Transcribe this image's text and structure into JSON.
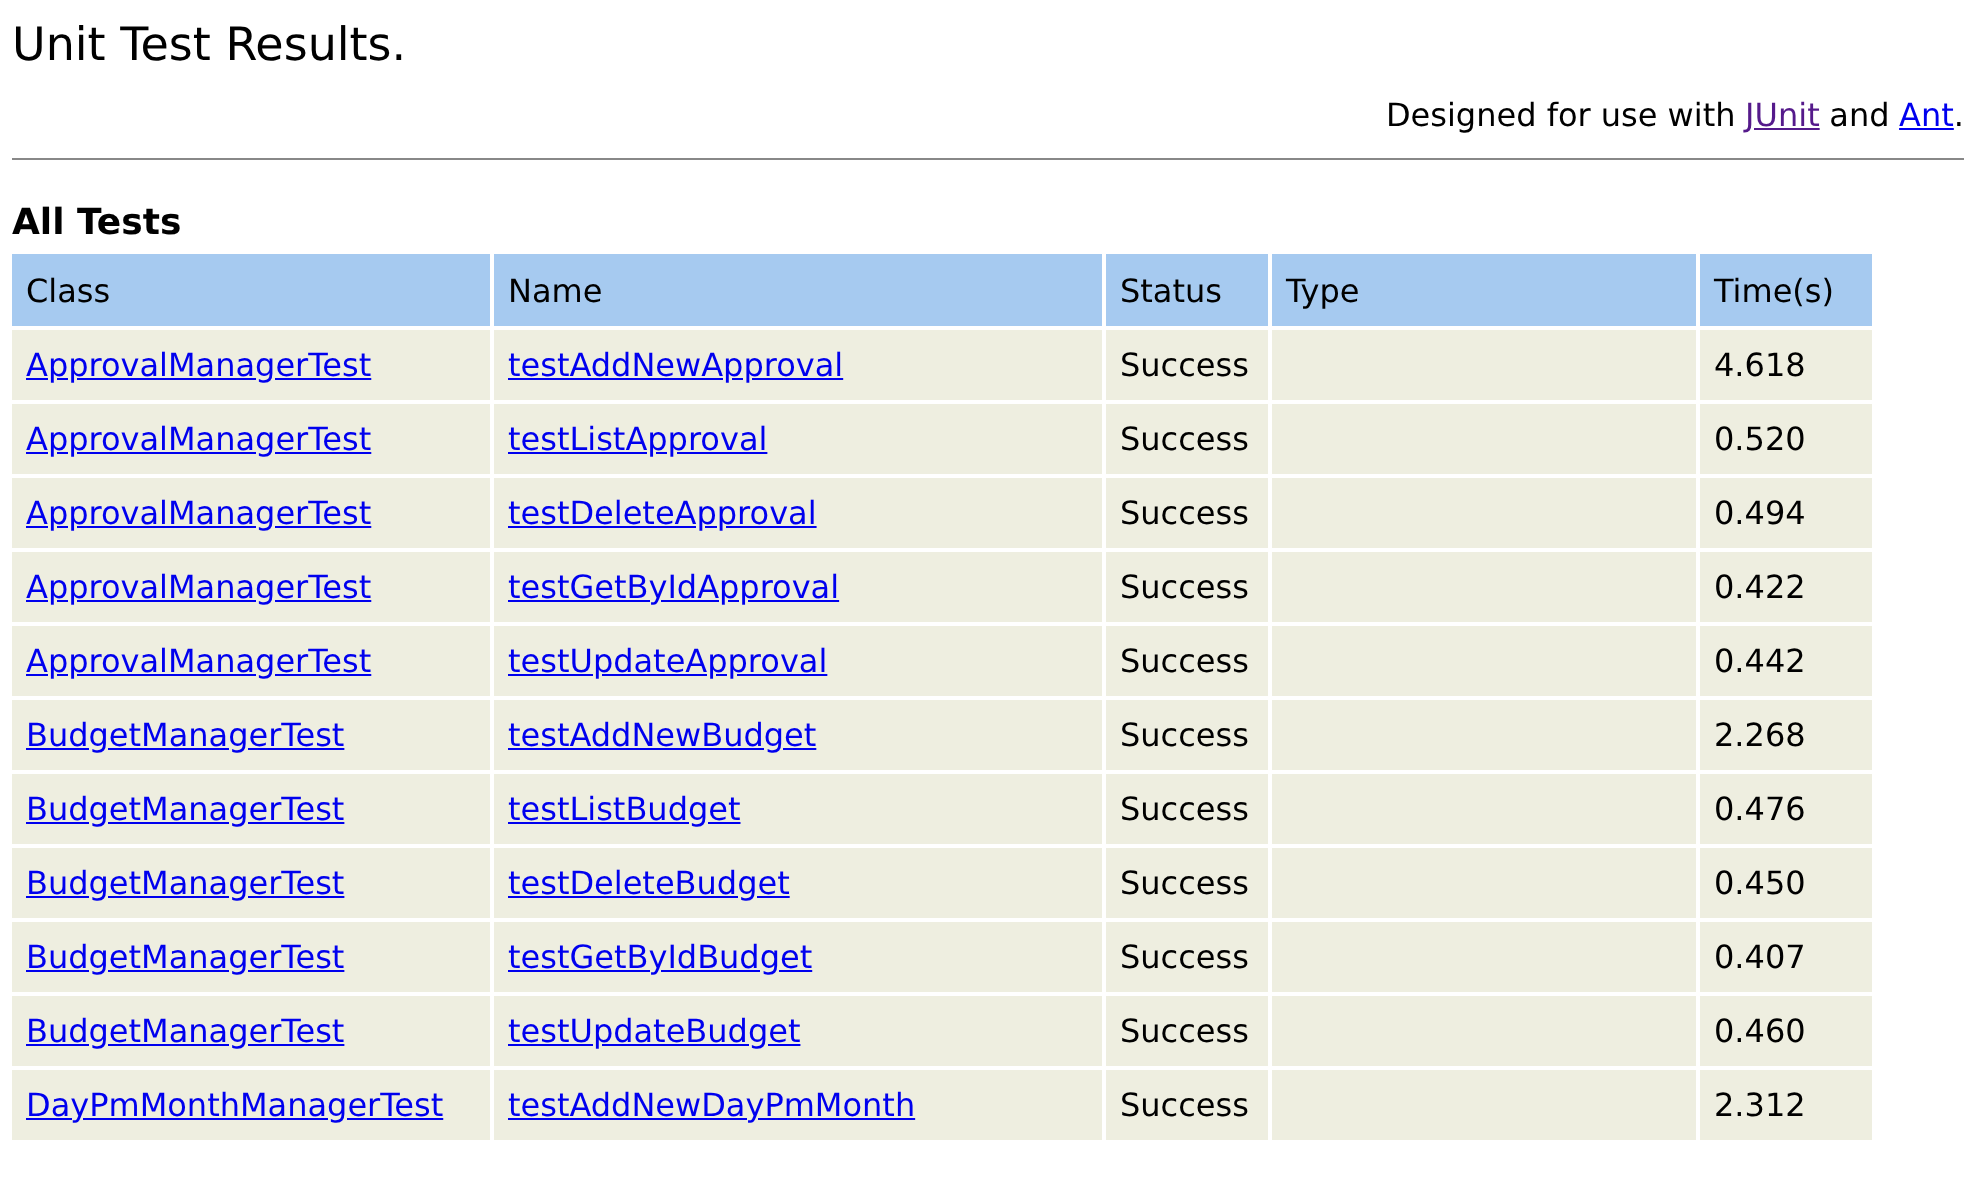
{
  "title": "Unit Test Results.",
  "credit": {
    "prefix": "Designed for use with",
    "links": [
      {
        "text": "JUnit",
        "visited": true
      },
      {
        "text": "Ant",
        "visited": false
      }
    ],
    "joiner": "and",
    "suffix": "."
  },
  "section_title": "All Tests",
  "table": {
    "columns": [
      "Class",
      "Name",
      "Status",
      "Type",
      "Time(s)"
    ],
    "rows": [
      {
        "class": "ApprovalManagerTest",
        "name": "testAddNewApproval",
        "status": "Success",
        "time": "4.618"
      },
      {
        "class": "ApprovalManagerTest",
        "name": "testListApproval",
        "status": "Success",
        "time": "0.520"
      },
      {
        "class": "ApprovalManagerTest",
        "name": "testDeleteApproval",
        "status": "Success",
        "time": "0.494"
      },
      {
        "class": "ApprovalManagerTest",
        "name": "testGetByIdApproval",
        "status": "Success",
        "time": "0.422"
      },
      {
        "class": "ApprovalManagerTest",
        "name": "testUpdateApproval",
        "status": "Success",
        "time": "0.442"
      },
      {
        "class": "BudgetManagerTest",
        "name": "testAddNewBudget",
        "status": "Success",
        "time": "2.268"
      },
      {
        "class": "BudgetManagerTest",
        "name": "testListBudget",
        "status": "Success",
        "time": "0.476"
      },
      {
        "class": "BudgetManagerTest",
        "name": "testDeleteBudget",
        "status": "Success",
        "time": "0.450"
      },
      {
        "class": "BudgetManagerTest",
        "name": "testGetByIdBudget",
        "status": "Success",
        "time": "0.407"
      },
      {
        "class": "BudgetManagerTest",
        "name": "testUpdateBudget",
        "status": "Success",
        "time": "0.460"
      },
      {
        "class": "DayPmMonthManagerTest",
        "name": "testAddNewDayPmMonth",
        "status": "Success",
        "time": "2.312"
      }
    ]
  }
}
